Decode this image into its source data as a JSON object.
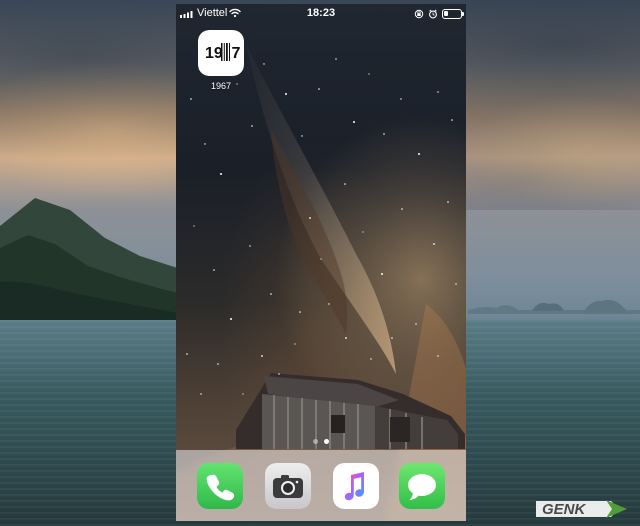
{
  "status_bar": {
    "carrier": "Viettel",
    "time": "18:23",
    "battery_level": 0.25
  },
  "home_screen": {
    "app_icon_label": "1967",
    "tile_text": "19",
    "tile_suffix": "7",
    "page_count": 2,
    "active_page": 1
  },
  "dock": {
    "apps": [
      {
        "name": "phone-app",
        "accent": "#34c759"
      },
      {
        "name": "camera-app",
        "accent": "#d1d1d6"
      },
      {
        "name": "music-app",
        "accent": "#ff3b5c"
      },
      {
        "name": "messages-app",
        "accent": "#34c759"
      }
    ]
  },
  "watermark": {
    "text": "GENK",
    "accent": "#4f9d35"
  }
}
